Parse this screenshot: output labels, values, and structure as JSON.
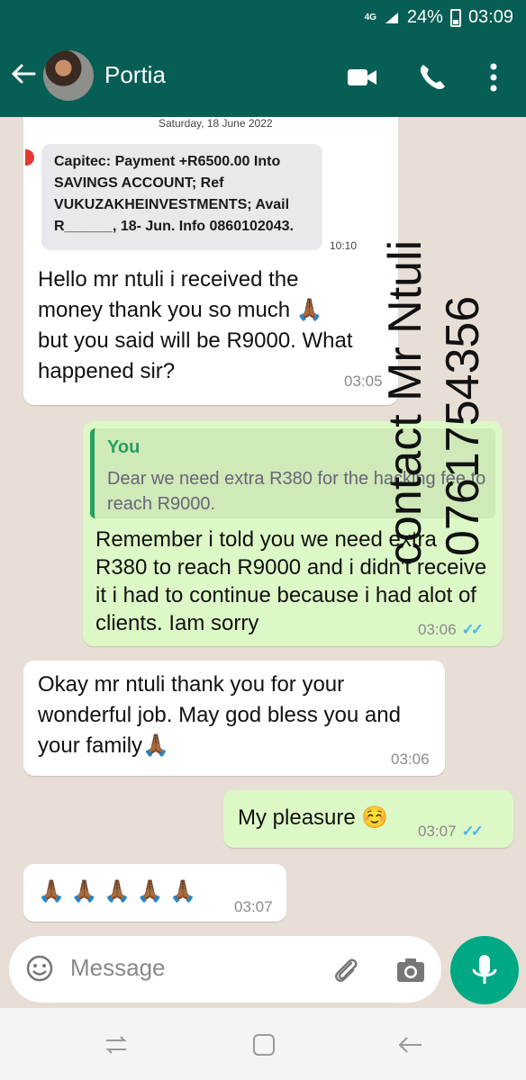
{
  "status_bar": {
    "network": "4G",
    "battery": "24%",
    "time": "03:09"
  },
  "header": {
    "contact_name": "Portia"
  },
  "chat": {
    "screenshot": {
      "date": "Saturday, 18 June 2022",
      "sms_text": "Capitec: Payment +R6500.00 Into SAVINGS ACCOUNT; Ref VUKUZAKHEINVESTMENTS; Avail R______, 18- Jun. Info 0860102043.",
      "sms_time": "10:10"
    },
    "messages": [
      {
        "text": "Hello mr ntuli i received the money thank you so much 🙏🏾 but you said will be R9000. What happened sir?",
        "time": "03:05"
      },
      {
        "quote_author": "You",
        "quote_text": "Dear we need extra R380 for the hacking fee to reach R9000.",
        "text": "Remember i told you we need extra R380 to reach R9000 and i didn't receive it i had to continue because i had alot of clients. Iam sorry",
        "time": "03:06"
      },
      {
        "text": "Okay mr ntuli thank you for your wonderful job. May god bless you and your family🙏🏾",
        "time": "03:06"
      },
      {
        "text": "My pleasure ☺️",
        "time": "03:07"
      },
      {
        "text": "🙏🏾 🙏🏾 🙏🏾 🙏🏾 🙏🏾",
        "time": "03:07"
      }
    ]
  },
  "watermark": {
    "line1": "contact Mr Ntuli",
    "line2": "0761754356"
  },
  "composer": {
    "placeholder": "Message"
  },
  "colors": {
    "header": "#075e54",
    "outgoing": "#dcf8c6",
    "incoming": "#ffffff",
    "mic": "#00a884",
    "ticks": "#4fb6ec"
  }
}
